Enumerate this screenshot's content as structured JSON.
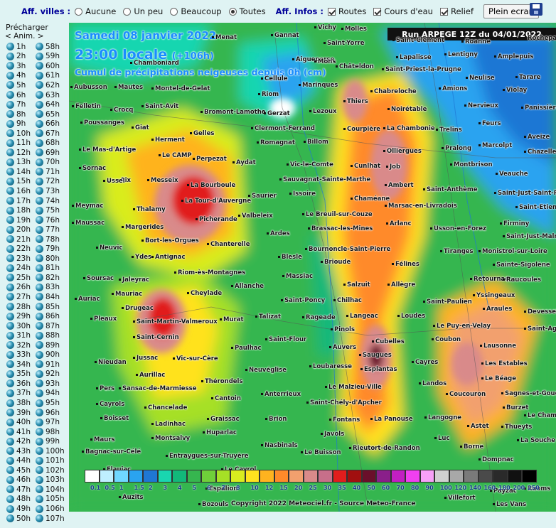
{
  "toolbar": {
    "villes_label": "Aff. villes :",
    "villes_options": [
      {
        "label": "Aucune",
        "checked": false
      },
      {
        "label": "Un peu",
        "checked": false
      },
      {
        "label": "Beaucoup",
        "checked": false
      },
      {
        "label": "Toutes",
        "checked": true
      }
    ],
    "infos_label": "Aff. Infos :",
    "infos_options": [
      {
        "label": "Routes",
        "checked": true
      },
      {
        "label": "Cours d'eau",
        "checked": true
      },
      {
        "label": "Relief",
        "checked": true
      }
    ],
    "fullscreen_label": "Plein ecran",
    "save_icon": "floppy-disk-icon"
  },
  "sidebar": {
    "preload_label": "Précharger",
    "anim_label": "< Anim. >",
    "left_frames": [
      "1h",
      "2h",
      "3h",
      "4h",
      "5h",
      "6h",
      "7h",
      "8h",
      "9h",
      "10h",
      "11h",
      "12h",
      "13h",
      "14h",
      "15h",
      "16h",
      "17h",
      "18h",
      "19h",
      "20h",
      "21h",
      "22h",
      "23h",
      "24h",
      "25h",
      "26h",
      "27h",
      "28h",
      "29h",
      "30h",
      "31h",
      "32h",
      "33h",
      "34h",
      "35h",
      "36h",
      "37h",
      "38h",
      "39h",
      "40h",
      "41h",
      "42h",
      "43h",
      "44h",
      "45h",
      "46h",
      "47h",
      "48h",
      "49h",
      "50h"
    ],
    "right_frames": [
      "58h",
      "59h",
      "60h",
      "61h",
      "62h",
      "63h",
      "64h",
      "65h",
      "66h",
      "67h",
      "68h",
      "69h",
      "70h",
      "71h",
      "72h",
      "73h",
      "74h",
      "75h",
      "76h",
      "77h",
      "78h",
      "79h",
      "80h",
      "81h",
      "82h",
      "83h",
      "84h",
      "85h",
      "86h",
      "87h",
      "88h",
      "89h",
      "90h",
      "91h",
      "92h",
      "93h",
      "94h",
      "95h",
      "96h",
      "97h",
      "98h",
      "99h",
      "100h",
      "101h",
      "102h",
      "103h",
      "104h",
      "105h",
      "106h",
      "107h"
    ]
  },
  "map": {
    "date": "Samedi 08 janvier 2022",
    "time": "23:00 locale",
    "offset": "(+106h)",
    "subtitle": "Cumul de précipitations neigeuses depuis 0h (cm)",
    "run": "Run ARPEGE 12Z du 04/01/2022",
    "copyright": "Copyright 2022 Meteociel.fr - Source Meteo-France",
    "cities": [
      "Gannat",
      "Vichy",
      "Molles",
      "Menat",
      "Saint-Yorre",
      "Saint-Clément",
      "Aigueperse",
      "Mons",
      "Lapalisse",
      "Cellule",
      "Marinques",
      "Châteldon",
      "Saint-Priest-la-Prugne",
      "Chamboniard",
      "Aubusson",
      "Mautes",
      "Montel-de-Gelat",
      "Riom",
      "Thiers",
      "Chabreloche",
      "Noirétable",
      "Felletin",
      "Crocq",
      "Saint-Avit",
      "Bromont-Lamothe",
      "Gerzat",
      "Lezoux",
      "Clermont-Ferrand",
      "Courpière",
      "La Chambonie",
      "Poussanges",
      "Giat",
      "Herment",
      "Gelles",
      "Romagnat",
      "Billom",
      "Olliergues",
      "Le Mas-d'Artige",
      "Le CAMP",
      "Perpezat",
      "Aydat",
      "Vic-le-Comte",
      "Cunlhat",
      "Job",
      "Sornac",
      "Aix",
      "Messeix",
      "La Bourboule",
      "Saint-Anthème",
      "Ussel",
      "Sauvagnat-Sainte-Marthe",
      "Ambert",
      "Meymac",
      "La Tour-d'Auvergne",
      "Saurier",
      "Issoire",
      "Chaméane",
      "Marsac-en-Livradois",
      "Thalamy",
      "Picherande",
      "Valbeleix",
      "Le Breuil-sur-Couze",
      "Maussac",
      "Margerides",
      "Arlanc",
      "Usson-en-Forez",
      "Ardes",
      "Brassac-les-Mines",
      "Neuvic",
      "Bort-les-Orgues",
      "Chanterelle",
      "Blesle",
      "Bournoncle-Saint-Pierre",
      "Ydes",
      "Antignac",
      "Brioude",
      "Félines",
      "Riom-ès-Montagnes",
      "Massiac",
      "Soursac",
      "Jaleyrac",
      "Allanche",
      "Salzuit",
      "Allègre",
      "Mauriac",
      "Cheylade",
      "Saint-Poncy",
      "Chilhac",
      "Saint-Paulien",
      "Auriac",
      "Drugeac",
      "Rageade",
      "Langeac",
      "Loudes",
      "Pleaux",
      "Saint-Martin-Valmeroux",
      "Murat",
      "Talizat",
      "Le Puy-en-Velay",
      "Saint-Cernin",
      "Saint-Flour",
      "Pinols",
      "Cubelles",
      "Coubon",
      "Lausonne",
      "Nieudan",
      "Jussac",
      "Vic-sur-Cère",
      "Paulhac",
      "Auvers",
      "Saugues",
      "Cayres",
      "Les Estables",
      "Aurillac",
      "Loubaresse",
      "Esplantas",
      "Le Béage",
      "Pers",
      "Sansac-de-Marmiesse",
      "Thérondels",
      "Neuvéglise",
      "Landos",
      "Cayrols",
      "Chancelade",
      "Cantoin",
      "Anterrieux",
      "Le Malzieu-Ville",
      "Coucouron",
      "Boisset",
      "Ladinhac",
      "Graissac",
      "Brion",
      "Saint-Chély-d'Apcher",
      "Langogne",
      "Burzet",
      "Maurs",
      "Montsalvy",
      "Huparlac",
      "Nasbinals",
      "Fontans",
      "La Panouse",
      "Astet",
      "Bagnac-sur-Célé",
      "Entraygues-sur-Truyère",
      "Le Buisson",
      "Javols",
      "Rieutort-de-Randon",
      "Luc",
      "Borne",
      "Villefort",
      "Lentigny",
      "Roanne",
      "Amplepuis",
      "Neulise",
      "Tarare",
      "Amions",
      "Violay",
      "Nervieux",
      "Panissières",
      "Feurs",
      "Trelins",
      "Pralong",
      "Marcolpt",
      "Montbrison",
      "Veauche",
      "Saint-Just-Saint-Rambert",
      "Saint-Etienne",
      "Firminy",
      "Saint-Just-Malmont",
      "Tiranges",
      "Monistrol-sur-Loire",
      "Sainte-Sigolène",
      "Retournac",
      "Raucoules",
      "Yssingeaux",
      "Araules",
      "Devesset",
      "Sagnes-et-Goudoulet",
      "Thueyts",
      "La Souche",
      "Dompnac",
      "Payzac",
      "Les Vans",
      "Ruoms",
      "Rochepaule",
      "Saint-Agrève",
      "Le Chambon",
      "Chazelles-sur-Lyon",
      "Aveize",
      "Saint-Germain-du-Teil",
      "Auzits",
      "Bozouls",
      "Espalion",
      "Le Cayrol",
      "Flaujac"
    ],
    "legend": [
      {
        "color": "#ffffff",
        "label": "0.1"
      },
      {
        "color": "#bfefff",
        "label": "0.5"
      },
      {
        "color": "#6fd7ff",
        "label": "1"
      },
      {
        "color": "#2aa3f0",
        "label": "1.5"
      },
      {
        "color": "#1f77d4",
        "label": "2"
      },
      {
        "color": "#19d6b0",
        "label": "3"
      },
      {
        "color": "#12b87a",
        "label": "4"
      },
      {
        "color": "#36b64f",
        "label": "5"
      },
      {
        "color": "#6fcf3a",
        "label": "6"
      },
      {
        "color": "#a6e026",
        "label": "7"
      },
      {
        "color": "#d9ec1f",
        "label": "8"
      },
      {
        "color": "#ffe21f",
        "label": "10"
      },
      {
        "color": "#ffb31f",
        "label": "12"
      },
      {
        "color": "#ff8a2a",
        "label": "15"
      },
      {
        "color": "#f2a06e",
        "label": "20"
      },
      {
        "color": "#d98a8a",
        "label": "25"
      },
      {
        "color": "#c76f8a",
        "label": "30"
      },
      {
        "color": "#e11d1d",
        "label": "35"
      },
      {
        "color": "#a10f0f",
        "label": "40"
      },
      {
        "color": "#6a0f2a",
        "label": "50"
      },
      {
        "color": "#8a1f8a",
        "label": "60"
      },
      {
        "color": "#c21fc2",
        "label": "70"
      },
      {
        "color": "#f040f0",
        "label": "80"
      },
      {
        "color": "#f7a0f7",
        "label": "90"
      },
      {
        "color": "#d0d0d0",
        "label": "100"
      },
      {
        "color": "#a8a8a8",
        "label": "120"
      },
      {
        "color": "#7a7a7a",
        "label": "140"
      },
      {
        "color": "#4a4a4a",
        "label": "160"
      },
      {
        "color": "#2a2a2a",
        "label": "180"
      },
      {
        "color": "#111111",
        "label": "200"
      },
      {
        "color": "#000000",
        "label": "250"
      }
    ]
  }
}
